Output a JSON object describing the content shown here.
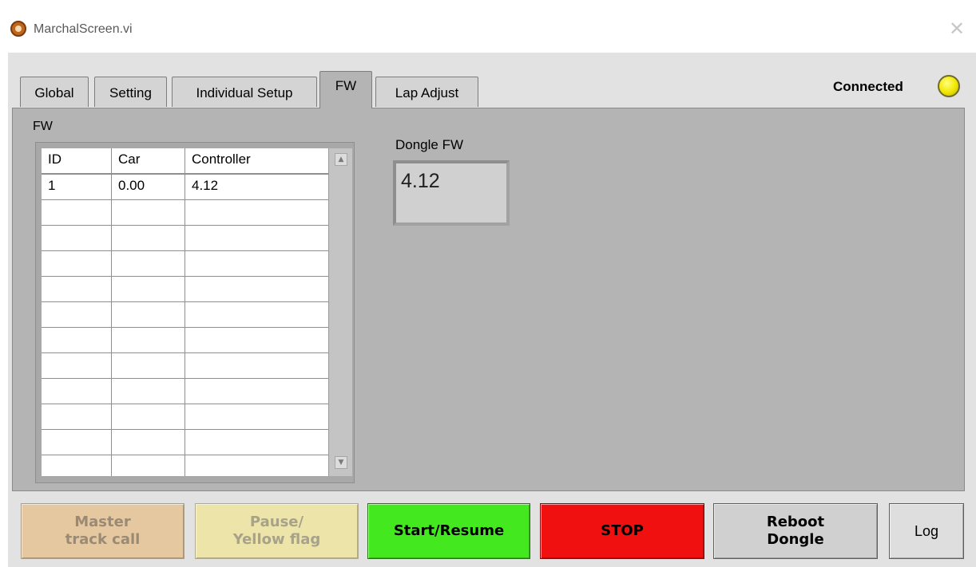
{
  "window": {
    "title": "MarchalScreen.vi",
    "close_symbol": "✕"
  },
  "tabs": [
    {
      "label": "Global",
      "active": false
    },
    {
      "label": "Setting",
      "active": false
    },
    {
      "label": "Individual Setup",
      "active": false
    },
    {
      "label": "FW",
      "active": true
    },
    {
      "label": "Lap Adjust",
      "active": false
    }
  ],
  "status": {
    "label": "Connected",
    "indicator_color": "#f0e600"
  },
  "fw_panel": {
    "label": "FW",
    "table": {
      "columns": [
        "ID",
        "Car",
        "Controller"
      ],
      "rows": [
        [
          "1",
          "0.00",
          "4.12"
        ]
      ]
    },
    "scroll_up_symbol": "▲",
    "scroll_down_symbol": "▼"
  },
  "dongle": {
    "label": "Dongle FW",
    "value": "4.12"
  },
  "buttons": {
    "master": "Master\ntrack call",
    "pause": "Pause/\nYellow flag",
    "start": "Start/Resume",
    "stop": "STOP",
    "reboot": "Reboot\nDongle",
    "log": "Log"
  },
  "colors": {
    "start": "#44e81e",
    "stop": "#f01010"
  }
}
